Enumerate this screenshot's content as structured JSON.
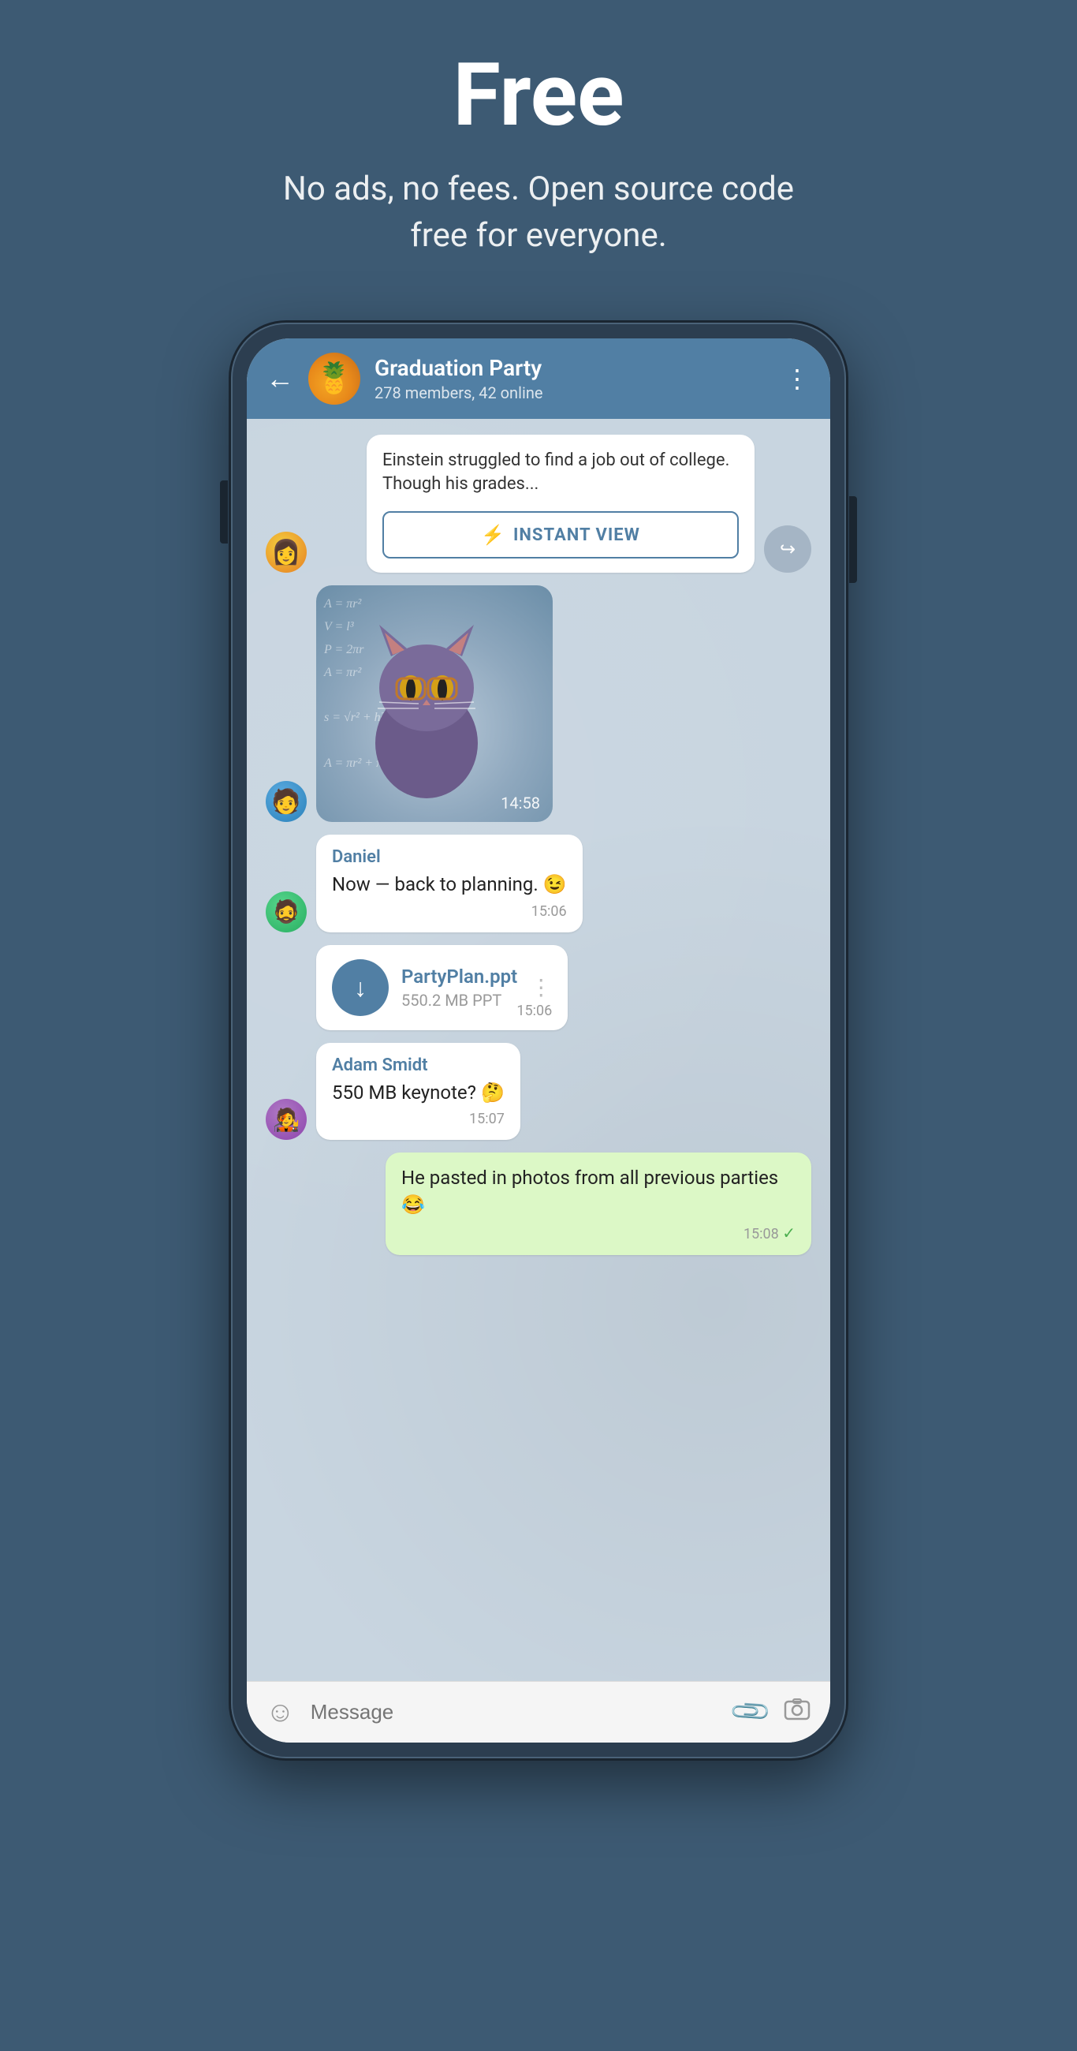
{
  "hero": {
    "title": "Free",
    "subtitle": "No ads, no fees. Open source code free for everyone."
  },
  "chat": {
    "header": {
      "group_name": "Graduation Party",
      "members_status": "278 members, 42 online"
    },
    "messages": [
      {
        "id": "msg1",
        "type": "article",
        "sender": "girl",
        "article_text": "Einstein struggled to find a job out of college. Though his grades...",
        "instant_view_label": "INSTANT VIEW"
      },
      {
        "id": "msg2",
        "type": "sticker",
        "sender": "guy1",
        "time": "14:58",
        "math_formula": "s = √r² + h²\nA = πr² + πrs"
      },
      {
        "id": "msg3",
        "type": "text",
        "sender": "guy2",
        "sender_name": "Daniel",
        "text": "Now — back to planning. 😉",
        "time": "15:06"
      },
      {
        "id": "msg4",
        "type": "file",
        "sender": "guy2",
        "file_name": "PartyPlan.ppt",
        "file_size": "550.2 MB PPT",
        "time": "15:06"
      },
      {
        "id": "msg5",
        "type": "text",
        "sender": "guy3",
        "sender_name": "Adam Smidt",
        "text": "550 MB keynote? 🤔",
        "time": "15:07"
      },
      {
        "id": "msg6",
        "type": "text",
        "sender": "self",
        "text": "He pasted in photos from all previous parties 😂",
        "time": "15:08",
        "bubble_color": "green"
      }
    ],
    "input": {
      "placeholder": "Message"
    }
  },
  "icons": {
    "back": "←",
    "menu": "⋮",
    "lightning": "⚡",
    "share": "↪",
    "download": "↓",
    "emoji": "☺",
    "attach": "📎",
    "camera": "⊙",
    "check": "✓"
  }
}
